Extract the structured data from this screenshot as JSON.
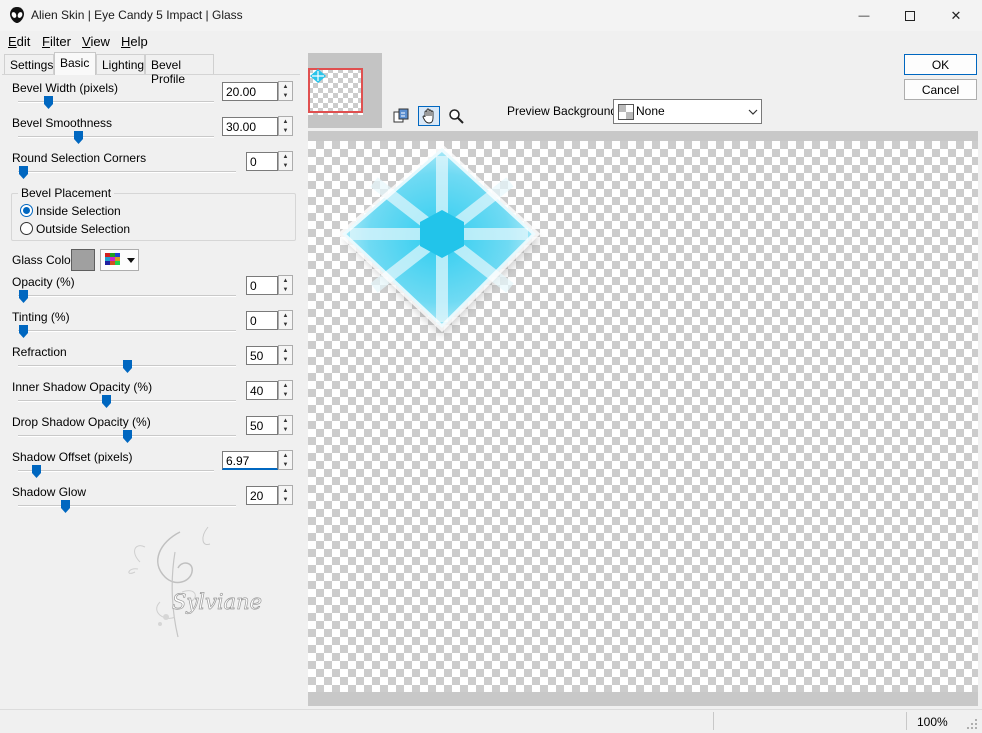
{
  "window": {
    "title": "Alien Skin | Eye Candy 5 Impact | Glass",
    "minimize_glyph": "—",
    "close_glyph": "✕"
  },
  "menu": [
    {
      "label": "Edit",
      "accel": "E"
    },
    {
      "label": "Filter",
      "accel": "F"
    },
    {
      "label": "View",
      "accel": "V"
    },
    {
      "label": "Help",
      "accel": "H"
    }
  ],
  "tabs": {
    "settings": "Settings",
    "basic": "Basic",
    "lighting": "Lighting",
    "bevel_profile": "Bevel Profile"
  },
  "params": {
    "bevel_width": {
      "label": "Bevel Width (pixels)",
      "value": "20.00",
      "level": 0.15
    },
    "bevel_smoothness": {
      "label": "Bevel Smoothness",
      "value": "30.00",
      "level": 0.3
    },
    "round_corners": {
      "label": "Round Selection Corners",
      "value": "0",
      "level": 0.0
    },
    "opacity": {
      "label": "Opacity (%)",
      "value": "0",
      "level": 0.0
    },
    "tinting": {
      "label": "Tinting (%)",
      "value": "0",
      "level": 0.0
    },
    "refraction": {
      "label": "Refraction",
      "value": "50",
      "level": 0.5
    },
    "inner_shadow_opacity": {
      "label": "Inner Shadow Opacity (%)",
      "value": "40",
      "level": 0.4
    },
    "drop_shadow_opacity": {
      "label": "Drop Shadow Opacity (%)",
      "value": "50",
      "level": 0.5
    },
    "shadow_offset": {
      "label": "Shadow Offset (pixels)",
      "value": "6.97",
      "level": 0.1
    },
    "shadow_glow": {
      "label": "Shadow Glow",
      "value": "20",
      "level": 0.2
    }
  },
  "bevel_placement": {
    "legend": "Bevel Placement",
    "inside": "Inside Selection",
    "outside": "Outside Selection",
    "selected": "inside"
  },
  "glass_color": {
    "label": "Glass Color",
    "color": "#a0a0a0"
  },
  "watermark": {
    "text": "Sylviane"
  },
  "preview": {
    "background_label": "Preview Background:",
    "background_value": "None"
  },
  "buttons": {
    "ok": "OK",
    "cancel": "Cancel"
  },
  "status": {
    "zoom": "100%"
  },
  "colors": {
    "accent": "#0067c0",
    "glass": "#29c4ea"
  }
}
